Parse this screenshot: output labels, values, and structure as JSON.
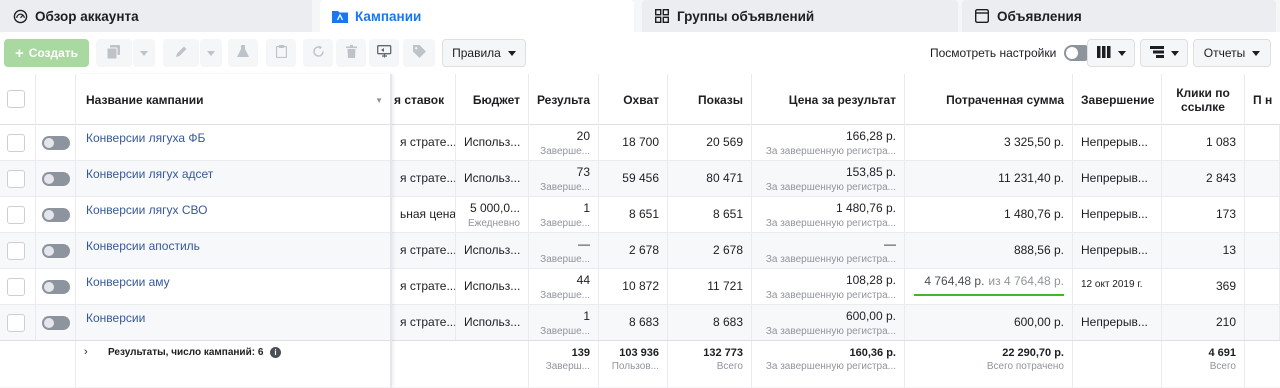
{
  "tabs": [
    {
      "label": "Обзор аккаунта",
      "icon": "dashboard-icon"
    },
    {
      "label": "Кампании",
      "icon": "campaign-folder-icon",
      "active": true
    },
    {
      "label": "Группы объявлений",
      "icon": "grid-icon"
    },
    {
      "label": "Объявления",
      "icon": "ad-window-icon"
    }
  ],
  "toolbar": {
    "create_label": "Создать",
    "rules_label": "Правила",
    "view_settings_label": "Посмотреть настройки",
    "reports_label": "Отчеты"
  },
  "columns": {
    "name": "Название кампании",
    "bid_strategy": "я ставок",
    "budget": "Бюджет",
    "results": "Результа",
    "reach": "Охват",
    "impressions": "Показы",
    "cost_per_result": "Цена за результат",
    "amount_spent": "Потраченная сумма",
    "ends": "Завершение",
    "link_clicks_line1": "Клики по",
    "link_clicks_line2": "ссылке",
    "more": "П н"
  },
  "rows": [
    {
      "name": "Конверсии лягуха ФБ",
      "bid": "я страте...",
      "budget": "Использ...",
      "budget_sub": "",
      "results": "20",
      "results_sub": "Заверше...",
      "reach": "18 700",
      "impressions": "20 569",
      "cpr": "166,28 р.",
      "cpr_sub": "За завершенную регистра...",
      "spent": "3 325,50 р.",
      "ends": "Непрерыв...",
      "clicks": "1 083"
    },
    {
      "name": "Конверсии лягух адсет",
      "bid": "я страте...",
      "budget": "Использ...",
      "budget_sub": "",
      "results": "73",
      "results_sub": "Заверше...",
      "reach": "59 456",
      "impressions": "80 471",
      "cpr": "153,85 р.",
      "cpr_sub": "За завершенную регистра...",
      "spent": "11 231,40 р.",
      "ends": "Непрерыв...",
      "clicks": "2 843"
    },
    {
      "name": "Конверсии лягух СВО",
      "bid": "ьная цена",
      "budget": "5 000,0...",
      "budget_sub": "Ежедневно",
      "results": "1",
      "results_sub": "Заверше...",
      "reach": "8 651",
      "impressions": "8 651",
      "cpr": "1 480,76 р.",
      "cpr_sub": "За завершенную регистра...",
      "spent": "1 480,76 р.",
      "ends": "Непрерыв...",
      "clicks": "173"
    },
    {
      "name": "Конверсии апостиль",
      "bid": "я страте...",
      "budget": "Использ...",
      "budget_sub": "",
      "results": "—",
      "results_sub": "Заверше...",
      "reach": "2 678",
      "impressions": "2 678",
      "cpr": "—",
      "cpr_sub": "За завершенную регистра...",
      "spent": "888,56 р.",
      "ends": "Непрерыв...",
      "clicks": "13"
    },
    {
      "name": "Конверсии аму",
      "bid": "я страте...",
      "budget": "Использ...",
      "budget_sub": "",
      "results": "44",
      "results_sub": "Заверше...",
      "reach": "10 872",
      "impressions": "11 721",
      "cpr": "108,28 р.",
      "cpr_sub": "За завершенную регистра...",
      "spent": "4 764,48 р.",
      "spent_of": "из 4 764,48 р.",
      "ends": "12 окт 2019 г.",
      "clicks": "369"
    },
    {
      "name": "Конверсии",
      "bid": "я страте...",
      "budget": "Использ...",
      "budget_sub": "",
      "results": "1",
      "results_sub": "Заверше...",
      "reach": "8 683",
      "impressions": "8 683",
      "cpr": "600,00 р.",
      "cpr_sub": "За завершенную регистра...",
      "spent": "600,00 р.",
      "ends": "Непрерыв...",
      "clicks": "210"
    }
  ],
  "totals": {
    "label": "Результаты, число кампаний: 6",
    "results": "139",
    "results_sub": "Заверш...",
    "reach": "103 936",
    "reach_sub": "Пользов...",
    "impressions": "132 773",
    "impressions_sub": "Всего",
    "cpr": "160,36 р.",
    "cpr_sub": "За завершенную регистра...",
    "spent": "22 290,70 р.",
    "spent_sub": "Всего потрачено",
    "clicks": "4 691",
    "clicks_sub": "Всего"
  },
  "colors": {
    "accent": "#1877f2",
    "link": "#365899",
    "create_button": "#a9d8a0",
    "progress": "#42b72a"
  }
}
